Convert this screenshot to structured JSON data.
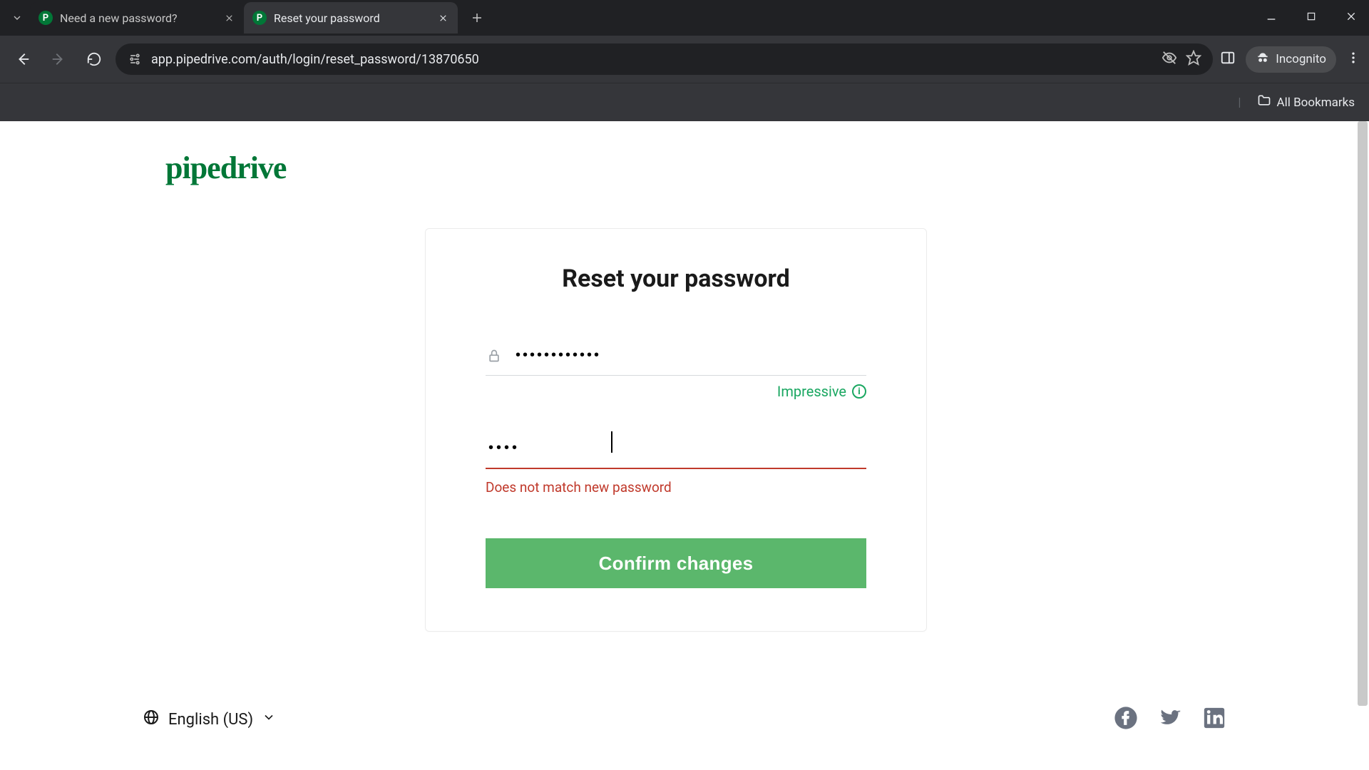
{
  "browser": {
    "tabs": [
      {
        "title": "Need a new password?",
        "active": false
      },
      {
        "title": "Reset your password",
        "active": true
      }
    ],
    "url": "app.pipedrive.com/auth/login/reset_password/13870650",
    "incognito_label": "Incognito",
    "all_bookmarks": "All Bookmarks"
  },
  "page": {
    "brand": "pipedrive",
    "heading": "Reset your password",
    "password_value": "••••••••••••",
    "strength_label": "Impressive",
    "confirm_value": "••••",
    "error_message": "Does not match new password",
    "submit_label": "Confirm changes"
  },
  "footer": {
    "language": "English (US)"
  }
}
